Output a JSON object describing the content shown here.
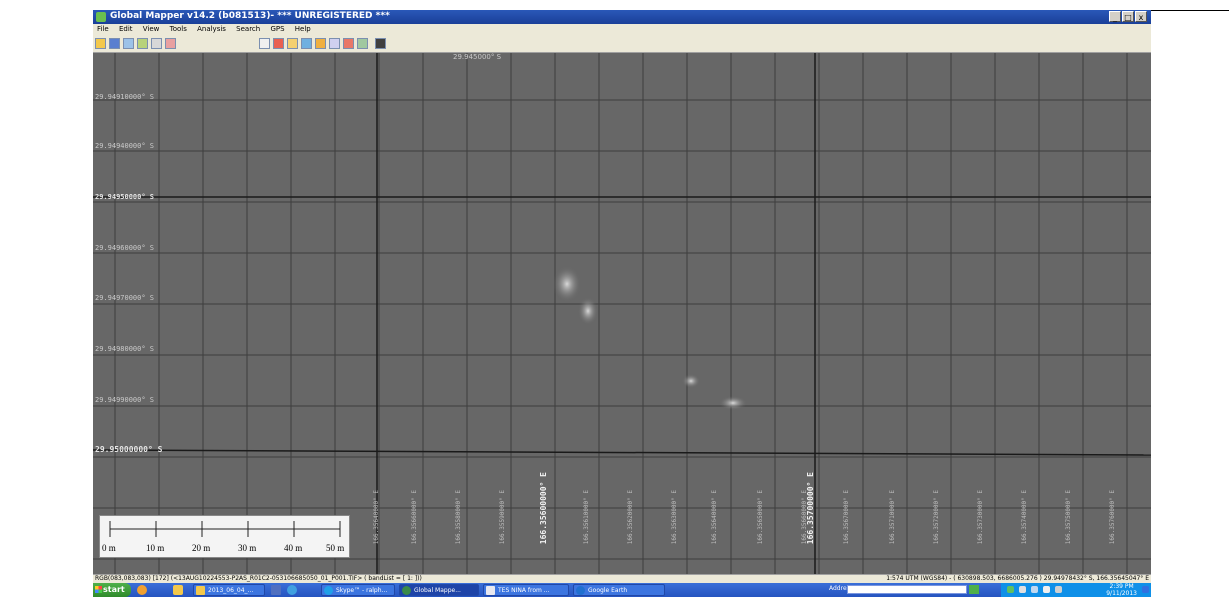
{
  "window": {
    "title": "Global Mapper v14.2 (b081513)- *** UNREGISTERED ***",
    "controls": [
      "_",
      "□",
      "x"
    ]
  },
  "menu": [
    "File",
    "Edit",
    "View",
    "Tools",
    "Analysis",
    "Search",
    "GPS",
    "Help"
  ],
  "map": {
    "top_partial_label": "29.945000° S",
    "lat_labels": [
      {
        "text": "29.94910000° S",
        "bold": false
      },
      {
        "text": "29.94940000° S",
        "bold": false
      },
      {
        "text": "29.94950000° S",
        "bold": true
      },
      {
        "text": "29.94960000° S",
        "bold": false
      },
      {
        "text": "29.94970000° S",
        "bold": false
      },
      {
        "text": "29.94980000° S",
        "bold": false
      },
      {
        "text": "29.94990000° S",
        "bold": false
      },
      {
        "text": "29.95000000° S",
        "bold": true
      }
    ],
    "lon_labels": [
      {
        "text": "166.35640000° E",
        "bold": false
      },
      {
        "text": "166.35660000° E",
        "bold": false
      },
      {
        "text": "166.35580000° E",
        "bold": false
      },
      {
        "text": "166.35590000° E",
        "bold": false
      },
      {
        "text": "166.35600000° E",
        "bold": true
      },
      {
        "text": "166.35610000° E",
        "bold": false
      },
      {
        "text": "166.35620000° E",
        "bold": false
      },
      {
        "text": "166.35630000° E",
        "bold": false
      },
      {
        "text": "166.35640000° E",
        "bold": false
      },
      {
        "text": "166.35650000° E",
        "bold": false
      },
      {
        "text": "166.35660000° E",
        "bold": false
      },
      {
        "text": "166.35670000° E",
        "bold": false
      },
      {
        "text": "166.35700000° E",
        "bold": true
      },
      {
        "text": "166.35710000° E",
        "bold": false
      },
      {
        "text": "166.35720000° E",
        "bold": false
      },
      {
        "text": "166.35730000° E",
        "bold": false
      },
      {
        "text": "166.35740000° E",
        "bold": false
      },
      {
        "text": "166.35750000° E",
        "bold": false
      },
      {
        "text": "166.35760000° E",
        "bold": false
      }
    ],
    "scale_labels": [
      "0 m",
      "10 m",
      "20 m",
      "30 m",
      "40 m",
      "50 m"
    ]
  },
  "status": {
    "left": "RGB(083,083,083) [172] (<13AUG10224553-P2AS_R01C2-053106685050_01_P001.TIF> ( bandList = [ 1: ]))",
    "right": "1:574  UTM (WGS84) - ( 630898.503, 6686005.276 ) 29.94978432° S, 166.35645047° E"
  },
  "taskbar": {
    "start": "start",
    "tasks": [
      "2013_06_04_...",
      "Skype™ - ralph...",
      "Global Mappe...",
      "TES NINA from ...",
      "Google Earth"
    ],
    "address_label": "Address",
    "clock_time": "2:39 PM",
    "clock_date": "9/11/2013"
  },
  "colors": {
    "map_bg": "#676767",
    "grid_line": "#3e3e3e",
    "major_line": "#1a1a1a",
    "taskbar": "#2654c0"
  }
}
